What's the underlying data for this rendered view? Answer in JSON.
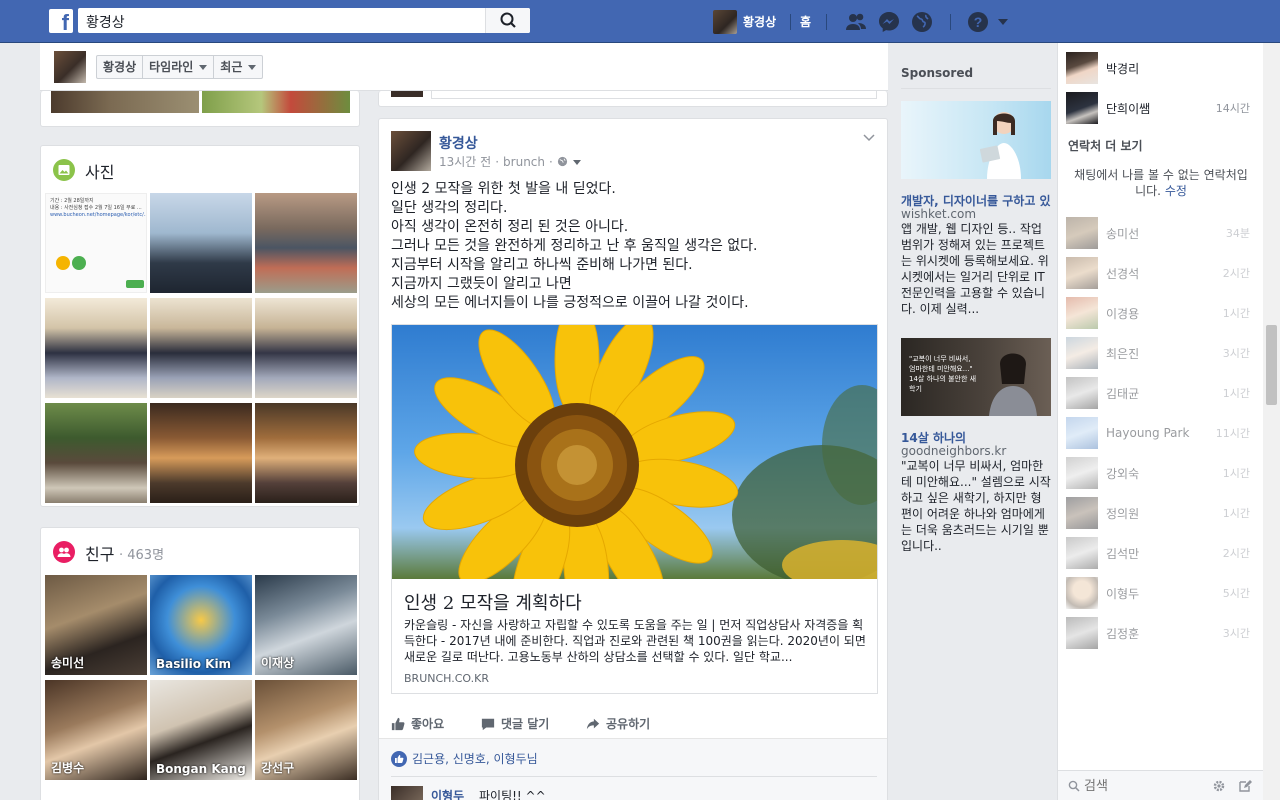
{
  "topbar": {
    "search_value": "황경상",
    "profile_name": "황경상",
    "home_label": "홈"
  },
  "subbar": {
    "name_label": "황경상",
    "timeline_label": "타임라인",
    "recent_label": "최근"
  },
  "photos": {
    "title": "사진",
    "doc_lines": [
      "기간 : 2월 28일까지",
      "내용 : 사전심청 접수 2월 7일 16일 무료 ...",
      "www.bucheon.net/homepage/kor/etc/..."
    ]
  },
  "friends": {
    "title": "친구",
    "count": "· 463명",
    "items": [
      {
        "name": "송미선"
      },
      {
        "name": "Basilio Kim"
      },
      {
        "name": "이재상"
      },
      {
        "name": "김병수"
      },
      {
        "name": "Bongan Kang"
      },
      {
        "name": "강선구"
      }
    ]
  },
  "post": {
    "author": "황경상",
    "time": "13시간 전",
    "source": "brunch",
    "text": "인생 2 모작을 위한 첫 발을 내 딛었다.\n일단 생각의 정리다.\n아직 생각이 온전히 정리 된 것은 아니다.\n그러나 모든 것을 완전하게 정리하고 난 후 움직일 생각은 없다.\n지금부터 시작을 알리고 하나씩 준비해 나가면 된다.\n지금까지 그랬듯이 알리고 나면\n세상의 모든 에너지들이 나를 긍정적으로 이끌어 나갈 것이다.",
    "link": {
      "title": "인생 2 모작을 계획하다",
      "description": "카운슬링 - 자신을 사랑하고 자립할 수 있도록 도움을 주는 일 | 먼저 직업상담사 자격증을 획득한다 - 2017년 내에 준비한다. 직업과 진로와 관련된 책 100권을 읽는다. 2020년이 되면 새로운 길로 떠난다. 고용노동부 산하의 상담소를 선택할 수 있다. 일단 학교...",
      "domain": "BRUNCH.CO.KR"
    },
    "actions": {
      "like": "좋아요",
      "comment": "댓글 달기",
      "share": "공유하기"
    },
    "likers": "김근용, 신명호, 이형두님",
    "comment_author": "이형두",
    "comment_text": "파이팅!! ^^"
  },
  "ads": {
    "heading": "Sponsored",
    "items": [
      {
        "title": "개발자, 디자이너를 구하고 있...",
        "domain": "wishket.com",
        "body": "앱 개발, 웹 디자인 등.. 작업 범위가 정해져 있는 프로젝트는 위시켓에 등록해보세요. 위시켓에서는 일거리 단위로 IT 전문인력을 고용할 수 있습니다. 이제 실력...",
        "image_caption": ""
      },
      {
        "title": "14살 하나의",
        "domain": "goodneighbors.kr",
        "body": "\"교복이 너무 비싸서, 엄마한테 미안해요...\" 설렘으로 시작하고 싶은 새학기, 하지만 형편이 어려운 하나와 엄마에게는 더욱 움츠러드는 시기일 뿐입니다..",
        "image_caption": "\"교복이 너무 비싸서,\n엄마한테 미안해요...\"\n14살 하나의 불안한 새 학기"
      }
    ]
  },
  "chat": {
    "top_contacts": [
      {
        "name": "박경리",
        "time": ""
      },
      {
        "name": "단희이쌤",
        "time": "14시간"
      }
    ],
    "more_contacts": "연락처 더 보기",
    "notice": "채팅에서 나를 볼 수 없는 연락처입니다.",
    "notice_link": "수정",
    "offline_contacts": [
      {
        "name": "송미선",
        "time": "34분"
      },
      {
        "name": "선경석",
        "time": "2시간"
      },
      {
        "name": "이경용",
        "time": "1시간"
      },
      {
        "name": "최은진",
        "time": "3시간"
      },
      {
        "name": "김태균",
        "time": "1시간"
      },
      {
        "name": "Hayoung Park",
        "time": "11시간"
      },
      {
        "name": "강외숙",
        "time": "1시간"
      },
      {
        "name": "정의원",
        "time": "1시간"
      },
      {
        "name": "김석만",
        "time": "2시간"
      },
      {
        "name": "이형두",
        "time": "5시간"
      },
      {
        "name": "김정훈",
        "time": "3시간"
      }
    ],
    "search_placeholder": "검색"
  }
}
